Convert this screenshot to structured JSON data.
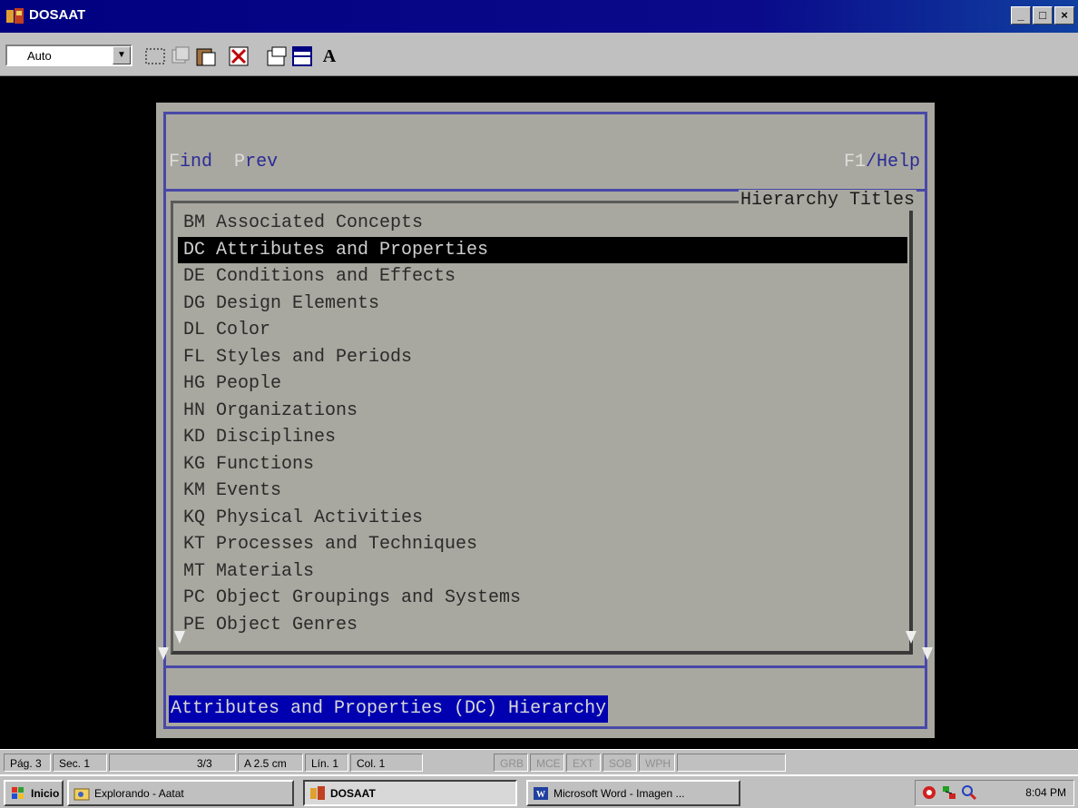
{
  "window": {
    "title": "DOSAAT",
    "buttons": [
      "_",
      "□",
      "×"
    ]
  },
  "toolbar": {
    "font_select": "Auto",
    "font_button_label": "A"
  },
  "dialog": {
    "menu_find_hotkey": "F",
    "menu_find_rest": "ind",
    "menu_prev_hotkey": "P",
    "menu_prev_rest": "rev",
    "help_hotkey": "F1",
    "help_rest": "/Help",
    "list_title": "Hierarchy Titles",
    "items": [
      {
        "label": "BM Associated Concepts"
      },
      {
        "label": "DC Attributes and Properties"
      },
      {
        "label": "DE Conditions and Effects"
      },
      {
        "label": "DG Design Elements"
      },
      {
        "label": "DL Color"
      },
      {
        "label": "FL Styles and Periods"
      },
      {
        "label": "HG People"
      },
      {
        "label": "HN Organizations"
      },
      {
        "label": "KD Disciplines"
      },
      {
        "label": "KG Functions"
      },
      {
        "label": "KM Events"
      },
      {
        "label": "KQ Physical Activities"
      },
      {
        "label": "KT Processes and Techniques"
      },
      {
        "label": "MT Materials"
      },
      {
        "label": "PC Object Groupings and Systems"
      },
      {
        "label": "PE Object Genres"
      }
    ],
    "selected_index": 1,
    "status_text": "Attributes and Properties (DC) Hierarchy"
  },
  "statusbar": {
    "page": "Pág. 3",
    "section": "Sec. 1",
    "pages": "3/3",
    "position": "A 2.5 cm",
    "line": "Lín. 1",
    "column": "Col. 1",
    "modes": [
      "GRB",
      "MCE",
      "EXT",
      "SOB",
      "WPH"
    ]
  },
  "taskbar": {
    "start_label": "Inicio",
    "tasks": [
      {
        "label": "Explorando - Aatat"
      },
      {
        "label": "DOSAAT"
      },
      {
        "label": "Microsoft Word - Imagen ..."
      }
    ],
    "clock": "8:04 PM"
  },
  "colors": {
    "title_bar": "#000080",
    "dialog_bg": "#a8a8a0",
    "dialog_border": "#4848a8",
    "status_highlight": "#0000b0",
    "selected_row": "#000000"
  }
}
